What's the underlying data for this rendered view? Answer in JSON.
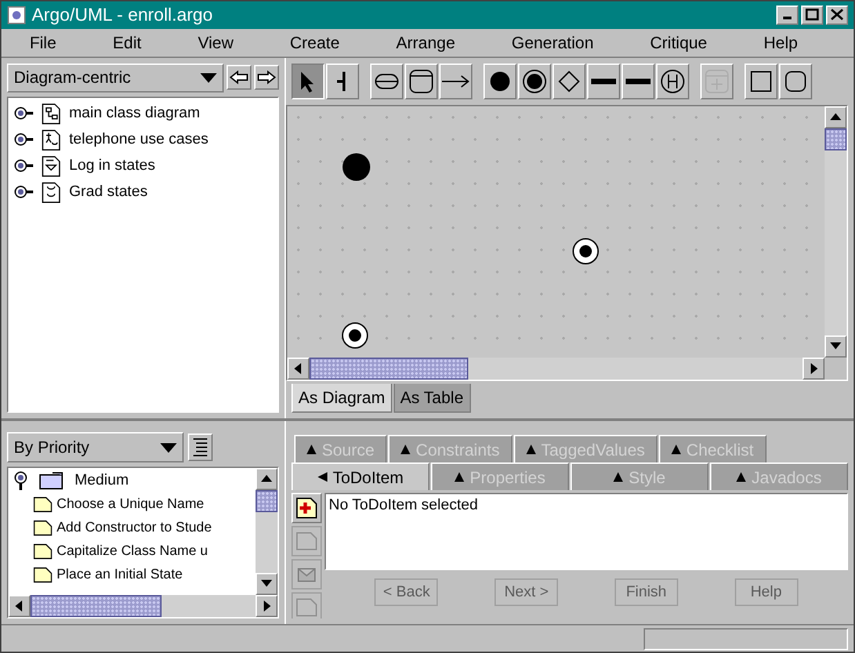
{
  "window": {
    "title": "Argo/UML - enroll.argo"
  },
  "menu": [
    "File",
    "Edit",
    "View",
    "Create",
    "Arrange",
    "Generation",
    "Critique",
    "Help"
  ],
  "navigator": {
    "perspective": "Diagram-centric",
    "diagrams": [
      {
        "label": "main class diagram",
        "kind": "class"
      },
      {
        "label": "telephone use cases",
        "kind": "usecase"
      },
      {
        "label": "Log in states",
        "kind": "state"
      },
      {
        "label": "Grad states",
        "kind": "state2"
      }
    ]
  },
  "toolbar": [
    {
      "kind": "select",
      "selected": true,
      "disabled": false
    },
    {
      "kind": "broom",
      "selected": false,
      "disabled": false
    },
    {
      "kind": "state",
      "selected": false,
      "disabled": false
    },
    {
      "kind": "composite",
      "selected": false,
      "disabled": false
    },
    {
      "kind": "transition",
      "selected": false,
      "disabled": false
    },
    {
      "kind": "initial",
      "selected": false,
      "disabled": false
    },
    {
      "kind": "final",
      "selected": false,
      "disabled": false
    },
    {
      "kind": "branch",
      "selected": false,
      "disabled": false
    },
    {
      "kind": "fork",
      "selected": false,
      "disabled": false
    },
    {
      "kind": "join",
      "selected": false,
      "disabled": false
    },
    {
      "kind": "history",
      "selected": false,
      "disabled": false
    },
    {
      "kind": "addcomp",
      "selected": false,
      "disabled": true
    },
    {
      "kind": "rect",
      "selected": false,
      "disabled": false
    },
    {
      "kind": "rrect",
      "selected": false,
      "disabled": false
    }
  ],
  "canvas": {
    "nodes": [
      {
        "kind": "initial"
      },
      {
        "kind": "final"
      },
      {
        "kind": "final"
      }
    ]
  },
  "view_tabs": [
    {
      "label": "As Diagram",
      "selected": true
    },
    {
      "label": "As Table",
      "selected": false
    }
  ],
  "todo": {
    "grouping": "By Priority",
    "group": "Medium",
    "items": [
      "Choose a Unique Name",
      "Add Constructor to Stude",
      "Capitalize Class Name u",
      "Place an Initial State"
    ]
  },
  "details": {
    "tabs_back": [
      {
        "label": "Source",
        "selected": false,
        "disabled": true
      },
      {
        "label": "Constraints",
        "selected": false,
        "disabled": true
      },
      {
        "label": "TaggedValues",
        "selected": false,
        "disabled": true
      },
      {
        "label": "Checklist",
        "selected": false,
        "disabled": true
      }
    ],
    "tabs_front": [
      {
        "label": "ToDoItem",
        "selected": true,
        "disabled": false
      },
      {
        "label": "Properties",
        "selected": false,
        "disabled": true
      },
      {
        "label": "Style",
        "selected": false,
        "disabled": true
      },
      {
        "label": "Javadocs",
        "selected": false,
        "disabled": true
      }
    ],
    "message": "No ToDoItem selected",
    "buttons": [
      {
        "label": "< Back",
        "disabled": true
      },
      {
        "label": "Next >",
        "disabled": true
      },
      {
        "label": "Finish",
        "disabled": true
      },
      {
        "label": "Help",
        "disabled": true
      }
    ]
  }
}
